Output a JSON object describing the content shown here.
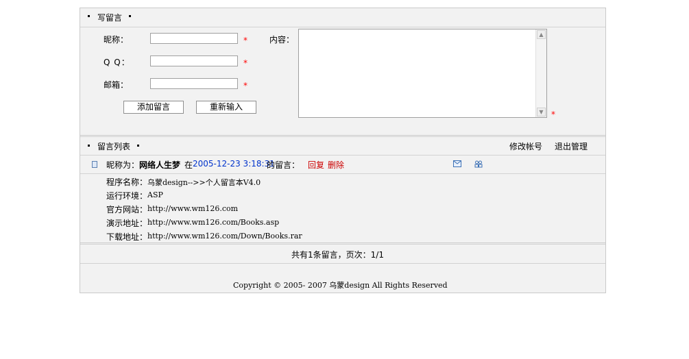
{
  "form_section": {
    "title": "写留言",
    "labels": {
      "nickname": "昵称：",
      "qq": "Q  Q：",
      "email": "邮箱：",
      "content": "内容："
    },
    "inputs": {
      "nickname": "",
      "qq": "",
      "email": "",
      "content": ""
    },
    "required_mark": "*",
    "buttons": {
      "submit": "添加留言",
      "reset": "重新输入"
    }
  },
  "list_section": {
    "title": "留言列表",
    "actions": {
      "edit_account": "修改帐号",
      "logout": "退出管理"
    },
    "message": {
      "nickname_prefix": "昵称为：",
      "nickname": "网络人生梦",
      "at": "在",
      "timestamp": "2005-12-23 3:18:31",
      "suffix": "的留言：",
      "reply": "回复",
      "delete": "删除",
      "lines": [
        {
          "label": "程序名称：",
          "value": "乌蒙design-->>个人留言本V4.0"
        },
        {
          "label": "运行环境：",
          "value": "ASP"
        },
        {
          "label": "官方网站：",
          "value": "http://www.wm126.com"
        },
        {
          "label": "演示地址：",
          "value": "http://www.wm126.com/Books.asp"
        },
        {
          "label": "下载地址：",
          "value": "http://www.wm126.com/Down/Books.rar"
        }
      ]
    },
    "pagination": "共有1条留言，页次：1/1"
  },
  "footer": {
    "copyright": "Copyright © 2005- 2007 乌蒙design All Rights Reserved"
  },
  "colors": {
    "panel_bg": "#f2f2f2",
    "border": "#c9c9c9",
    "link_blue": "#0033cc",
    "action_red": "#cc0000",
    "required_red": "#ff0000"
  },
  "icons": {
    "message": "document-icon",
    "email_action": "email-icon",
    "qq_action": "qq-icon"
  }
}
